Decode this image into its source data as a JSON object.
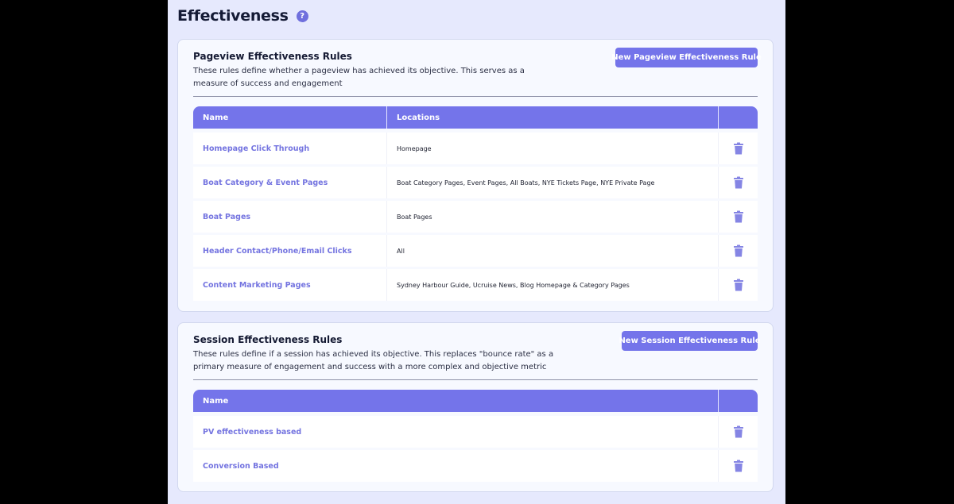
{
  "page": {
    "title": "Effectiveness",
    "help_glyph": "?"
  },
  "pageview": {
    "title": "Pageview Effectiveness Rules",
    "description": "These rules define whether a pageview has achieved its objective. This serves as a measure of success and engagement",
    "new_button": "New Pageview Effectiveness Rule",
    "columns": [
      "Name",
      "Locations",
      ""
    ],
    "rows": [
      {
        "name": "Homepage Click Through",
        "locations": "Homepage"
      },
      {
        "name": "Boat Category & Event Pages",
        "locations": "Boat Category Pages, Event Pages, All Boats, NYE Tickets Page, NYE Private Page"
      },
      {
        "name": "Boat Pages",
        "locations": "Boat Pages"
      },
      {
        "name": "Header Contact/Phone/Email Clicks",
        "locations": "All"
      },
      {
        "name": "Content Marketing Pages",
        "locations": "Sydney Harbour Guide, Ucruise News, Blog Homepage & Category Pages"
      }
    ]
  },
  "session": {
    "title": "Session Effectiveness Rules",
    "description": "These rules define if a session has achieved its objective. This replaces \"bounce rate\" as a primary measure of engagement and success with a more complex and objective metric",
    "new_button": "New Session Effectiveness Rule",
    "columns": [
      "Name",
      ""
    ],
    "rows": [
      {
        "name": "PV effectiveness based"
      },
      {
        "name": "Conversion Based"
      }
    ]
  },
  "icons": {
    "help": "question-circle-icon",
    "delete": "trash-icon"
  },
  "colors": {
    "accent": "#7474ea",
    "link": "#7474e0",
    "background": "#e6e9fd",
    "card": "#f7f9ff"
  }
}
